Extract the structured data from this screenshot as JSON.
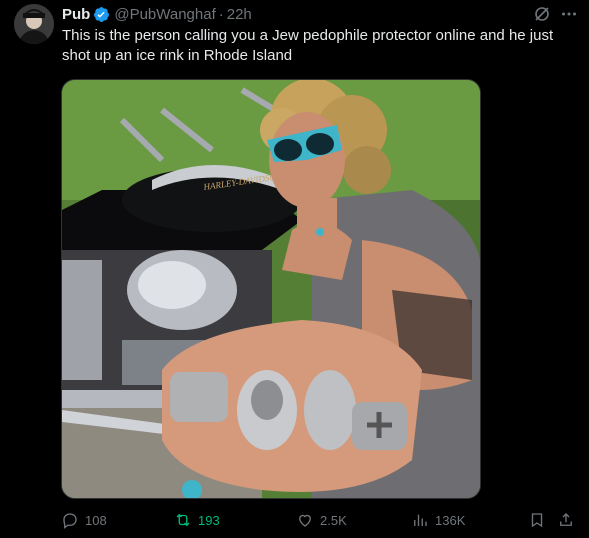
{
  "tweet": {
    "author_name": "Pub",
    "handle": "@PubWanghaf",
    "separator": "·",
    "timestamp": "22h",
    "text": "This is the person calling you a Jew pedophile protector online and he just shot up an ice rink in Rhode Island",
    "verified": true
  },
  "media": {
    "motorcycle_tank_brand": "HARLEY-DAVIDSON"
  },
  "actions": {
    "replies": "108",
    "reposts": "193",
    "likes": "2.5K",
    "views": "136K"
  },
  "colors": {
    "background": "#000000",
    "text": "#e7e9ea",
    "muted": "#71767b",
    "verified": "#1d9bf0",
    "repost_active": "#00ba7c"
  }
}
